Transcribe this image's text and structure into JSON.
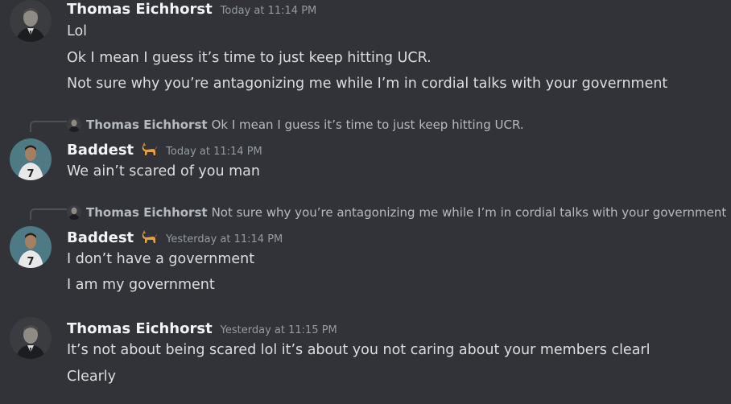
{
  "messages": [
    {
      "author": "Thomas Eichhorst",
      "timestamp": "Today at 11:14 PM",
      "avatar": "man-in-suit-avatar",
      "lines": [
        "Lol",
        "Ok I mean I guess it’s time to just keep hitting UCR.",
        "Not sure why you’re antagonizing me while I’m in cordial talks with your government"
      ]
    },
    {
      "reply_to": {
        "author": "Thomas Eichhorst",
        "text": "Ok I mean I guess it’s time to just keep hitting UCR."
      },
      "author": "Baddest",
      "badge_icon": "dog-emoji",
      "timestamp": "Today at 11:14 PM",
      "avatar": "soccer-player-number-7-avatar",
      "lines": [
        "We ain’t scared of you man"
      ]
    },
    {
      "reply_to": {
        "author": "Thomas Eichhorst",
        "text": "Not sure why you’re antagonizing me while I’m in cordial talks with your government"
      },
      "author": "Baddest",
      "badge_icon": "dog-emoji",
      "timestamp": "Yesterday at 11:14 PM",
      "avatar": "soccer-player-number-7-avatar",
      "lines": [
        "I don’t have a government",
        "I am my government"
      ]
    },
    {
      "author": "Thomas Eichhorst",
      "timestamp": "Yesterday at 11:15 PM",
      "avatar": "man-in-suit-avatar",
      "lines": [
        "It’s not about being scared lol it’s about you not caring about your members clearl",
        "Clearly"
      ]
    }
  ],
  "colors": {
    "background": "#313338",
    "username": "#f2f3f5",
    "text": "#dbdee1",
    "timestamp": "#949ba4",
    "reply_text": "#b5bac1"
  }
}
